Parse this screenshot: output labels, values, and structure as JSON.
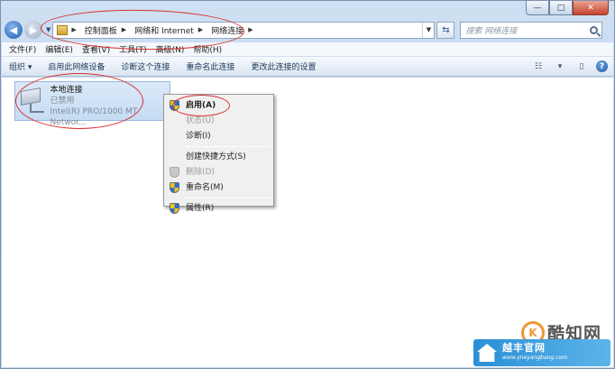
{
  "window": {
    "minimize_glyph": "—",
    "maximize_glyph": "□",
    "close_glyph": "✕"
  },
  "address": {
    "breadcrumbs": [
      "控制面板",
      "网络和 Internet",
      "网络连接"
    ],
    "search_placeholder": "搜索 网络连接"
  },
  "menubar": {
    "items": [
      "文件(F)",
      "编辑(E)",
      "查看(V)",
      "工具(T)",
      "高级(N)",
      "帮助(H)"
    ]
  },
  "toolbar": {
    "items": [
      "组织 ▾",
      "启用此网络设备",
      "诊断这个连接",
      "重命名此连接",
      "更改此连接的设置"
    ],
    "help": "?"
  },
  "connection": {
    "name": "本地连接",
    "status": "已禁用",
    "adapter": "Intel(R) PRO/1000 MT Networ..."
  },
  "context_menu": {
    "items": [
      {
        "label": "启用(A)",
        "icon": "shield-icon",
        "style": "bold"
      },
      {
        "label": "状态(U)",
        "icon": "",
        "style": "disabled"
      },
      {
        "label": "诊断(I)",
        "icon": "",
        "style": "normal"
      },
      {
        "label": "创建快捷方式(S)",
        "icon": "",
        "style": "normal"
      },
      {
        "label": "删除(D)",
        "icon": "shield-icon",
        "style": "disabled"
      },
      {
        "label": "重命名(M)",
        "icon": "shield-icon",
        "style": "normal"
      },
      {
        "label": "属性(R)",
        "icon": "shield-icon",
        "style": "normal"
      }
    ]
  },
  "watermark": {
    "brand": "酷知网",
    "site_name": "越丰官网",
    "site_url": "www.yneyangbang.com"
  },
  "colors": {
    "annotation": "#d9302c",
    "selection": "#c5dcf3",
    "shield_blue": "#2d6fd2",
    "shield_yellow": "#f2c618"
  }
}
